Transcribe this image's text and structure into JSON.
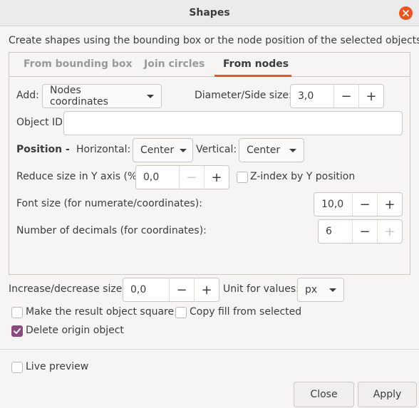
{
  "window": {
    "title": "Shapes"
  },
  "intro": "Create shapes using the bounding box or the node position of the selected objects",
  "tabs": [
    {
      "label": "From bounding box",
      "active": false
    },
    {
      "label": "Join circles",
      "active": false
    },
    {
      "label": "From nodes",
      "active": true
    }
  ],
  "from_nodes": {
    "add_label": "Add:",
    "add_value": "Nodes coordinates",
    "diameter_label": "Diameter/Side size:",
    "diameter_value": "3,0",
    "object_id_label": "Object ID",
    "object_id_value": "",
    "position_label": "Position -",
    "horizontal_label": "Horizontal:",
    "horizontal_value": "Center",
    "vertical_label": "Vertical:",
    "vertical_value": "Center",
    "reduce_label": "Reduce size in Y axis (%):",
    "reduce_value": "0,0",
    "zindex_label": "Z-index by Y position",
    "zindex_checked": false,
    "font_size_label": "Font size (for numerate/coordinates):",
    "font_size_value": "10,0",
    "decimals_label": "Number of decimals (for coordinates):",
    "decimals_value": "6"
  },
  "common": {
    "increase_label": "Increase/decrease size:",
    "increase_value": "0,0",
    "unit_label": "Unit for values:",
    "unit_value": "px",
    "square_label": "Make the result object square",
    "square_checked": false,
    "copy_fill_label": "Copy fill from selected",
    "copy_fill_checked": false,
    "delete_origin_label": "Delete origin object",
    "delete_origin_checked": true
  },
  "footer": {
    "live_preview_label": "Live preview",
    "live_preview_checked": false,
    "close_label": "Close",
    "apply_label": "Apply"
  },
  "spin_symbols": {
    "minus": "−",
    "plus": "+"
  },
  "colors": {
    "accent": "#e95420",
    "check": "#8b4a7c"
  }
}
